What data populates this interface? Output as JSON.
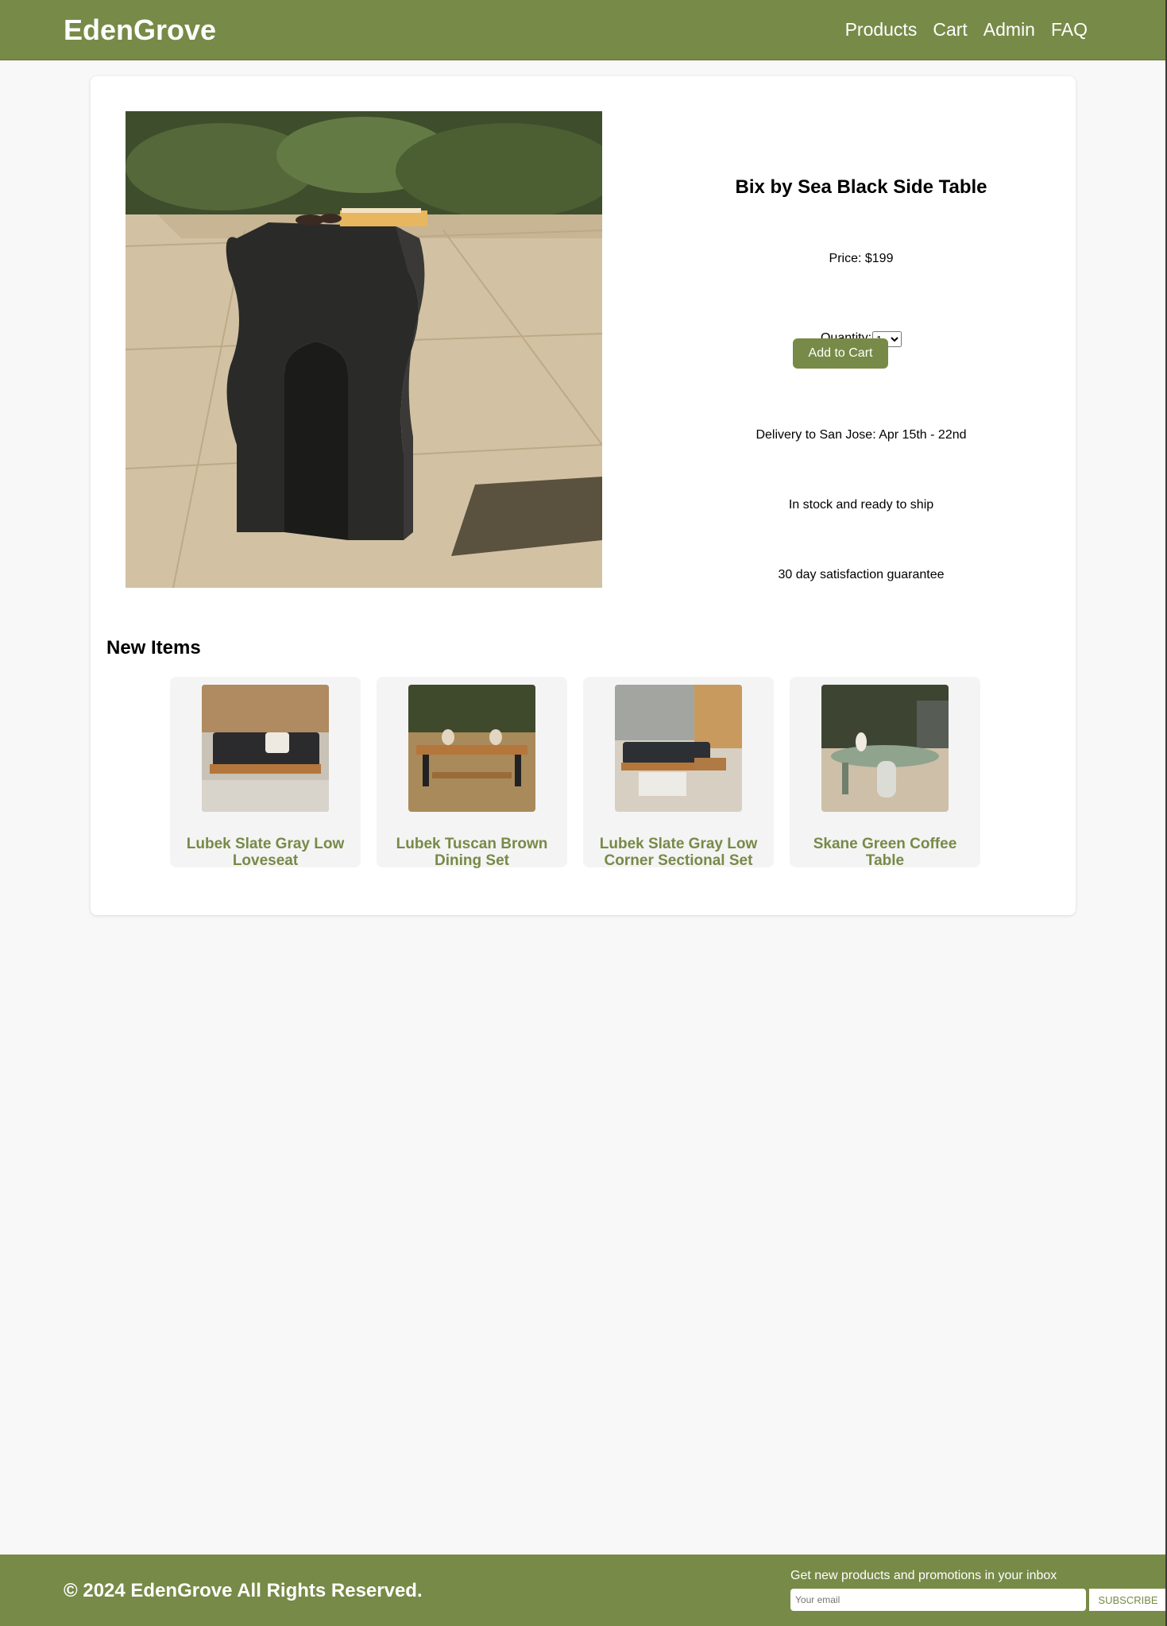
{
  "header": {
    "brand": "EdenGrove",
    "nav": [
      "Products",
      "Cart",
      "Admin",
      "FAQ"
    ]
  },
  "product": {
    "image": "black wavy arch side table on stone patio",
    "title": "Bix by Sea Black Side Table",
    "price": "Price: $199",
    "quantity_label": "Quantity:",
    "quantity_value": "1",
    "add_to_cart_label": "Add to Cart",
    "delivery": "Delivery to San Jose: Apr 15th - 22nd",
    "stock": "In stock and ready to ship",
    "guarantee": "30 day satisfaction guarantee"
  },
  "new_items": {
    "title": "New Items",
    "items": [
      {
        "name": "Lubek Slate Gray Low Loveseat",
        "image": "loveseat"
      },
      {
        "name": "Lubek Tuscan Brown Dining Set",
        "image": "dining set"
      },
      {
        "name": "Lubek Slate Gray Low Corner Sectional Set",
        "image": "sectional"
      },
      {
        "name": "Skane Green Coffee Table",
        "image": "coffee table"
      }
    ]
  },
  "footer": {
    "copyright": "© 2024 EdenGrove All Rights Reserved.",
    "subscribe_label": "Get new products and promotions in your inbox",
    "email_placeholder": "Your email",
    "subscribe_button": "SUBSCRIBE"
  },
  "colors": {
    "brand": "#778a47",
    "background": "#f8f8f8"
  }
}
